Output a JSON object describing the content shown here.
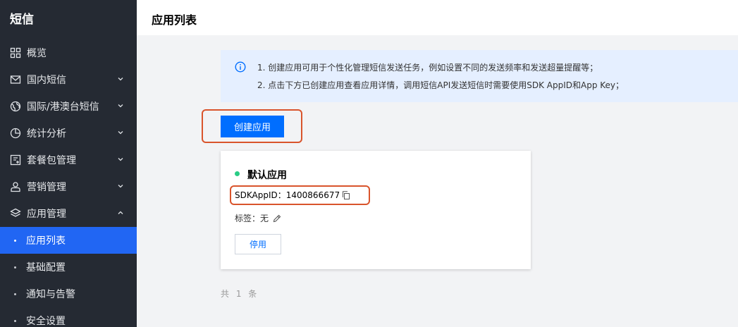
{
  "sidebar": {
    "title": "短信",
    "items": [
      {
        "label": "概览",
        "icon": "grid-icon",
        "chevron": false
      },
      {
        "label": "国内短信",
        "icon": "mail-icon",
        "chevron": true
      },
      {
        "label": "国际/港澳台短信",
        "icon": "globe-icon",
        "chevron": true
      },
      {
        "label": "统计分析",
        "icon": "pie-chart-icon",
        "chevron": true
      },
      {
        "label": "套餐包管理",
        "icon": "package-icon",
        "chevron": true
      },
      {
        "label": "营销管理",
        "icon": "user-icon",
        "chevron": true
      },
      {
        "label": "应用管理",
        "icon": "layers-icon",
        "chevron": true,
        "expanded": true
      }
    ],
    "sub_items": [
      {
        "label": "应用列表",
        "active": true
      },
      {
        "label": "基础配置",
        "active": false
      },
      {
        "label": "通知与告警",
        "active": false
      },
      {
        "label": "安全设置",
        "active": false
      }
    ]
  },
  "header": {
    "title": "应用列表"
  },
  "info": {
    "line1": "1. 创建应用可用于个性化管理短信发送任务，例如设置不同的发送频率和发送超量提醒等；",
    "line2": "2. 点击下方已创建应用查看应用详情，调用短信API发送短信时需要使用SDK AppID和App Key；"
  },
  "create_button": "创建应用",
  "app_card": {
    "name": "默认应用",
    "sdk_label": "SDKAppID：",
    "sdk_value": "1400866677",
    "tag_label": "标签：",
    "tag_value": "无",
    "disable_button": "停用",
    "status_color": "#29cc85"
  },
  "total": "共 1 条",
  "colors": {
    "accent": "#006eff",
    "active_nav": "#2166f3",
    "highlight": "#d9542c",
    "sidebar_bg": "#252a33"
  }
}
